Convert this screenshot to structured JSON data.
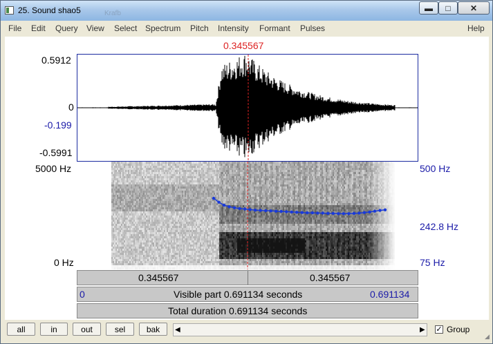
{
  "window": {
    "title": "25. Sound shao5",
    "ghost_text": "Krafb"
  },
  "window_buttons": {
    "minimize": "▬",
    "maximize": "□",
    "close": "✕"
  },
  "menu": {
    "items": [
      "File",
      "Edit",
      "Query",
      "View",
      "Select",
      "Spectrum",
      "Pitch",
      "Intensity",
      "Formant",
      "Pulses"
    ],
    "help": "Help"
  },
  "cursor": {
    "time": "0.345567",
    "time_fraction": 0.5
  },
  "waveform": {
    "y_max": "0.5912",
    "y_zero": "0",
    "y_cursor_value": "-0.199",
    "y_min": "-0.5991"
  },
  "spectrogram": {
    "freq_max": "5000 Hz",
    "freq_min": "0 Hz",
    "pitch_max": "500 Hz",
    "pitch_cursor": "242.8 Hz",
    "pitch_min": "75 Hz"
  },
  "pitch_track_hz": [
    262,
    245,
    232,
    226,
    222,
    219,
    217,
    215,
    213,
    212,
    211,
    210,
    209,
    208,
    207,
    206,
    205,
    204,
    203,
    203,
    202,
    202,
    201,
    201,
    200,
    200,
    200,
    201,
    202,
    204,
    206,
    209,
    212,
    214
  ],
  "time_bar": {
    "left": "0.345567",
    "right": "0.345567"
  },
  "visible_bar": {
    "start": "0",
    "label": "Visible part 0.691134 seconds",
    "end": "0.691134"
  },
  "total_bar": {
    "label": "Total duration 0.691134 seconds"
  },
  "bottom_buttons": {
    "all": "all",
    "in": "in",
    "out": "out",
    "sel": "sel",
    "bak": "bak"
  },
  "scroll": {
    "left_arrow": "◀",
    "right_arrow": "▶"
  },
  "group": {
    "checked": "✓",
    "label": "Group"
  },
  "colors": {
    "cursor": "#dd2222",
    "pitch": "#1a3ad8",
    "frame": "#1a2aa0"
  }
}
